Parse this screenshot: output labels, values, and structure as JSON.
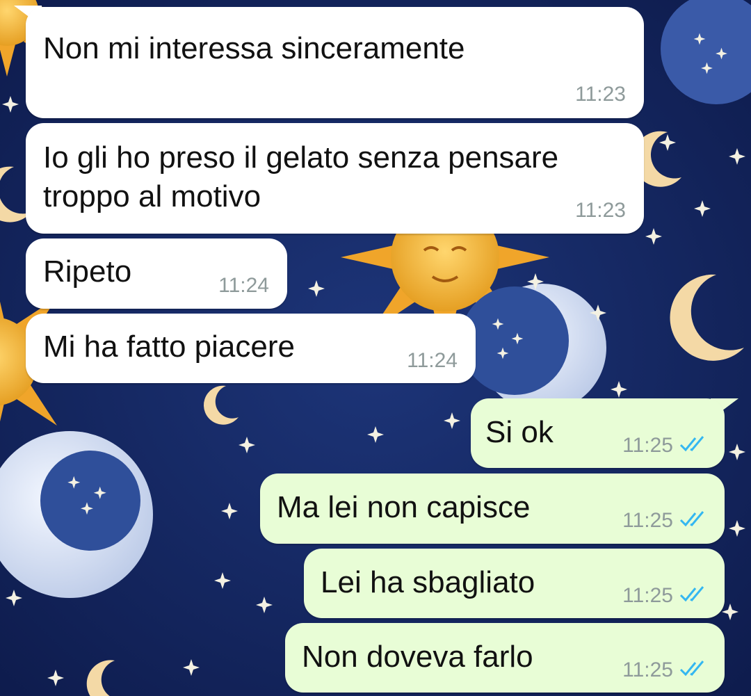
{
  "colors": {
    "incoming_bubble": "#ffffff",
    "outgoing_bubble": "#e8fdd6",
    "timestamp": "#8e9a9a",
    "read_ticks": "#34b7f1",
    "wallpaper_base": "#13245f",
    "sun": "#f2b233",
    "moon": "#dce6f5"
  },
  "wallpaper": {
    "motif": "celestial-suns-moons-stars",
    "icons": [
      "sun-icon",
      "moon-icon",
      "star-icon"
    ]
  },
  "messages": [
    {
      "direction": "incoming",
      "text": "Non mi interessa sinceramente",
      "time": "11:23"
    },
    {
      "direction": "incoming",
      "text": "Io gli ho preso il gelato senza pensare\ntroppo al motivo",
      "time": "11:23"
    },
    {
      "direction": "incoming",
      "text": "Ripeto",
      "time": "11:24"
    },
    {
      "direction": "incoming",
      "text": "Mi ha fatto piacere",
      "time": "11:24"
    },
    {
      "direction": "outgoing",
      "text": "Si ok",
      "time": "11:25",
      "status": "read",
      "status_icon": "double-check-icon"
    },
    {
      "direction": "outgoing",
      "text": "Ma lei non capisce",
      "time": "11:25",
      "status": "read",
      "status_icon": "double-check-icon"
    },
    {
      "direction": "outgoing",
      "text": "Lei ha sbagliato",
      "time": "11:25",
      "status": "read",
      "status_icon": "double-check-icon"
    },
    {
      "direction": "outgoing",
      "text": "Non doveva farlo",
      "time": "11:25",
      "status": "read",
      "status_icon": "double-check-icon"
    }
  ]
}
